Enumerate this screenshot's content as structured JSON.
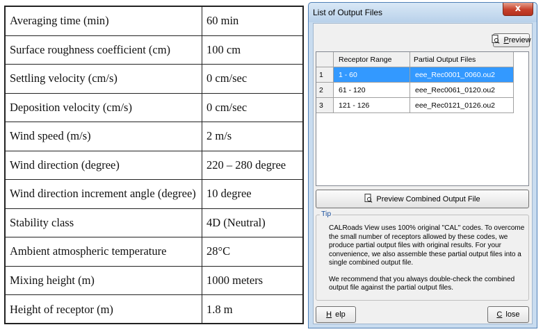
{
  "params": [
    {
      "name": "Averaging time (min)",
      "value": "60 min"
    },
    {
      "name": "Surface roughness coefficient (cm)",
      "value": "100 cm"
    },
    {
      "name": "Settling velocity (cm/s)",
      "value": "0 cm/sec"
    },
    {
      "name": "Deposition velocity (cm/s)",
      "value": "0 cm/sec"
    },
    {
      "name": "Wind speed (m/s)",
      "value": "2 m/s"
    },
    {
      "name": "Wind direction (degree)",
      "value": "220 – 280 degree"
    },
    {
      "name": "Wind direction increment angle (degree)",
      "value": "10 degree"
    },
    {
      "name": "Stability class",
      "value": "4D (Neutral)"
    },
    {
      "name": "Ambient atmospheric temperature",
      "value": "28°C"
    },
    {
      "name": "Mixing height (m)",
      "value": "1000 meters"
    },
    {
      "name": "Height of receptor (m)",
      "value": "1.8 m"
    }
  ],
  "dialog": {
    "title": "List of Output Files",
    "close_glyph": "x",
    "preview_label": "Preview",
    "preview_combined_label": "Preview Combined Output File",
    "help_label": "Help",
    "close_label": "Close",
    "grid": {
      "headers": [
        "Receptor Range",
        "Partial Output Files"
      ],
      "rows": [
        {
          "num": "1",
          "range": "1 - 60",
          "file": "eee_Rec0001_0060.ou2",
          "selected": true
        },
        {
          "num": "2",
          "range": "61 - 120",
          "file": "eee_Rec0061_0120.ou2",
          "selected": false
        },
        {
          "num": "3",
          "range": "121 - 126",
          "file": "eee_Rec0121_0126.ou2",
          "selected": false
        }
      ]
    },
    "tip": {
      "label": "Tip",
      "para1": "CALRoads View uses 100% original \"CAL\" codes.  To overcome the small number of receptors allowed by these codes, we produce partial output files with original results.  For your convenience, we also assemble these partial output files into a single combined output file.",
      "para2": "We recommend that you always double-check the combined output file against the partial output files."
    }
  }
}
